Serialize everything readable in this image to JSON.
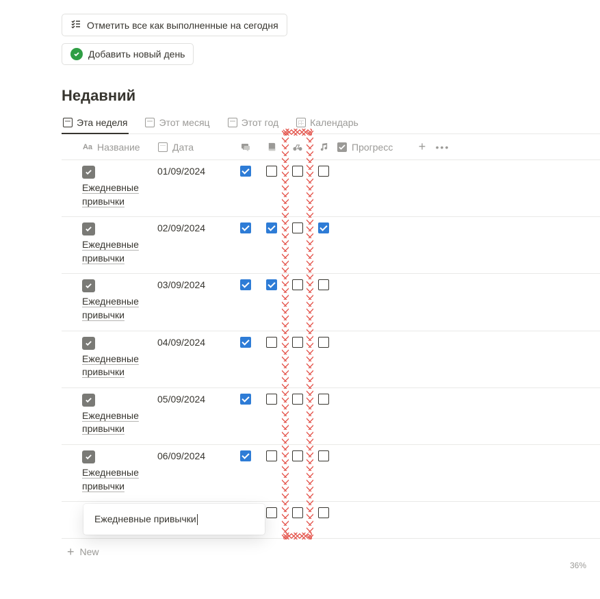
{
  "buttons": {
    "mark_all": "Отметить все как выполненные на сегодня",
    "add_day": "Добавить новый день"
  },
  "heading": "Недавний",
  "tabs": [
    {
      "label": "Эта неделя",
      "active": true
    },
    {
      "label": "Этот месяц",
      "active": false
    },
    {
      "label": "Этот год",
      "active": false
    },
    {
      "label": "Календарь",
      "active": false
    }
  ],
  "columns": {
    "name": "Название",
    "date": "Дата",
    "progress": "Прогресс"
  },
  "icon_cols": [
    "chat-icon",
    "book-icon",
    "bike-icon",
    "music-icon"
  ],
  "rows": [
    {
      "title": "Ежедневные привычки",
      "date": "01/09/2024",
      "checks": [
        true,
        false,
        false,
        false
      ]
    },
    {
      "title": "Ежедневные привычки",
      "date": "02/09/2024",
      "checks": [
        true,
        true,
        false,
        true
      ]
    },
    {
      "title": "Ежедневные привычки",
      "date": "03/09/2024",
      "checks": [
        true,
        true,
        false,
        false
      ]
    },
    {
      "title": "Ежедневные привычки",
      "date": "04/09/2024",
      "checks": [
        true,
        false,
        false,
        false
      ]
    },
    {
      "title": "Ежедневные привычки",
      "date": "05/09/2024",
      "checks": [
        true,
        false,
        false,
        false
      ]
    },
    {
      "title": "Ежедневные привычки",
      "date": "06/09/2024",
      "checks": [
        true,
        false,
        false,
        false
      ]
    }
  ],
  "new_row_label": "New",
  "popover_text": "Ежедневные привычки",
  "footer_pct": "36%"
}
